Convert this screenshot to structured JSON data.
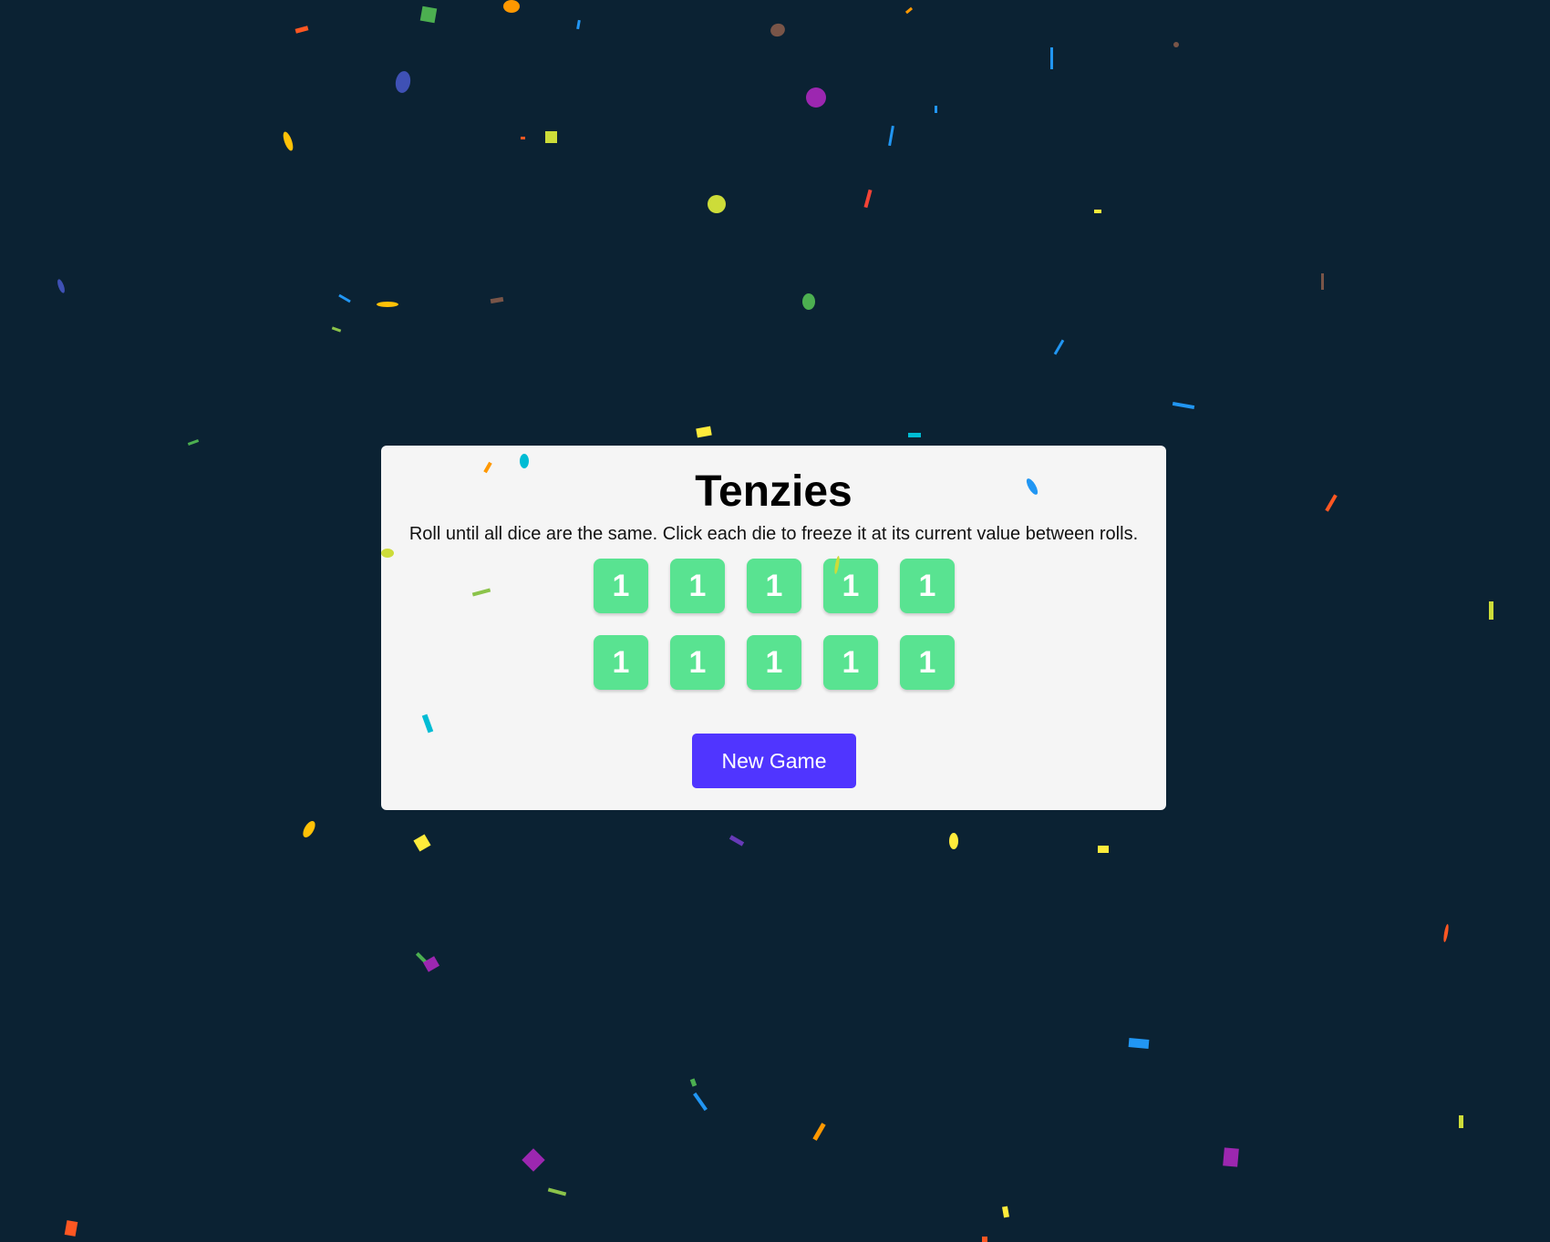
{
  "game": {
    "title": "Tenzies",
    "instructions": "Roll until all dice are the same. Click each die to freeze it at its current value between rolls.",
    "dice": [
      {
        "value": "1",
        "held": true
      },
      {
        "value": "1",
        "held": true
      },
      {
        "value": "1",
        "held": true
      },
      {
        "value": "1",
        "held": true
      },
      {
        "value": "1",
        "held": true
      },
      {
        "value": "1",
        "held": true
      },
      {
        "value": "1",
        "held": true
      },
      {
        "value": "1",
        "held": true
      },
      {
        "value": "1",
        "held": true
      },
      {
        "value": "1",
        "held": true
      }
    ],
    "new_game_label": "New Game"
  },
  "colors": {
    "page_background": "#0b2233",
    "card_background": "#f5f5f5",
    "die_held": "#59e391",
    "button": "#5035ff"
  },
  "confetti": {
    "visible": true,
    "palette": [
      "#f44336",
      "#e91e63",
      "#9c27b0",
      "#673ab7",
      "#3f51b5",
      "#2196f3",
      "#03a9f4",
      "#00bcd4",
      "#4caf50",
      "#8bc34a",
      "#cddc39",
      "#ffeb3b",
      "#ffc107",
      "#ff9800",
      "#ff5722",
      "#795548"
    ]
  }
}
